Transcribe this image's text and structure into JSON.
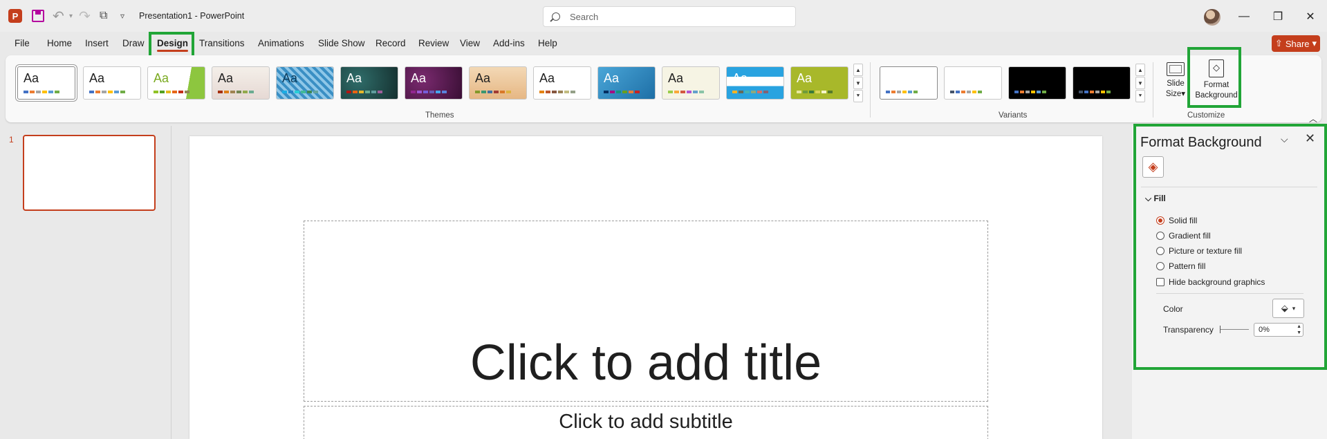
{
  "app": {
    "doc_title": "Presentation1  -  PowerPoint",
    "search_placeholder": "Search",
    "logo_letter": "P"
  },
  "menu": {
    "tabs": [
      "File",
      "Home",
      "Insert",
      "Draw",
      "Design",
      "Transitions",
      "Animations",
      "Slide Show",
      "Record",
      "Review",
      "View",
      "Add-ins",
      "Help"
    ],
    "active": "Design",
    "share_label": "Share"
  },
  "ribbon": {
    "themes_label": "Themes",
    "variants_label": "Variants",
    "customize_label": "Customize",
    "theme_sample": "Aa",
    "slide_size": {
      "line1": "Slide",
      "line2": "Size"
    },
    "format_background": {
      "line1": "Format",
      "line2": "Background"
    }
  },
  "thumbnails": {
    "slide_number": "1"
  },
  "slide": {
    "title_placeholder": "Click to add title",
    "subtitle_placeholder": "Click to add subtitle"
  },
  "format_pane": {
    "title": "Format Background",
    "section": "Fill",
    "options": [
      {
        "label": "Solid fill",
        "selected": true
      },
      {
        "label": "Gradient fill",
        "selected": false
      },
      {
        "label": "Picture or texture fill",
        "selected": false
      },
      {
        "label": "Pattern fill",
        "selected": false
      }
    ],
    "hide_graphics_label": "Hide background graphics",
    "hide_graphics_checked": false,
    "color_label": "Color",
    "transparency_label": "Transparency",
    "transparency_value": "0%"
  },
  "colors": {
    "accent": "#c43e1c",
    "highlight": "#21a537"
  }
}
